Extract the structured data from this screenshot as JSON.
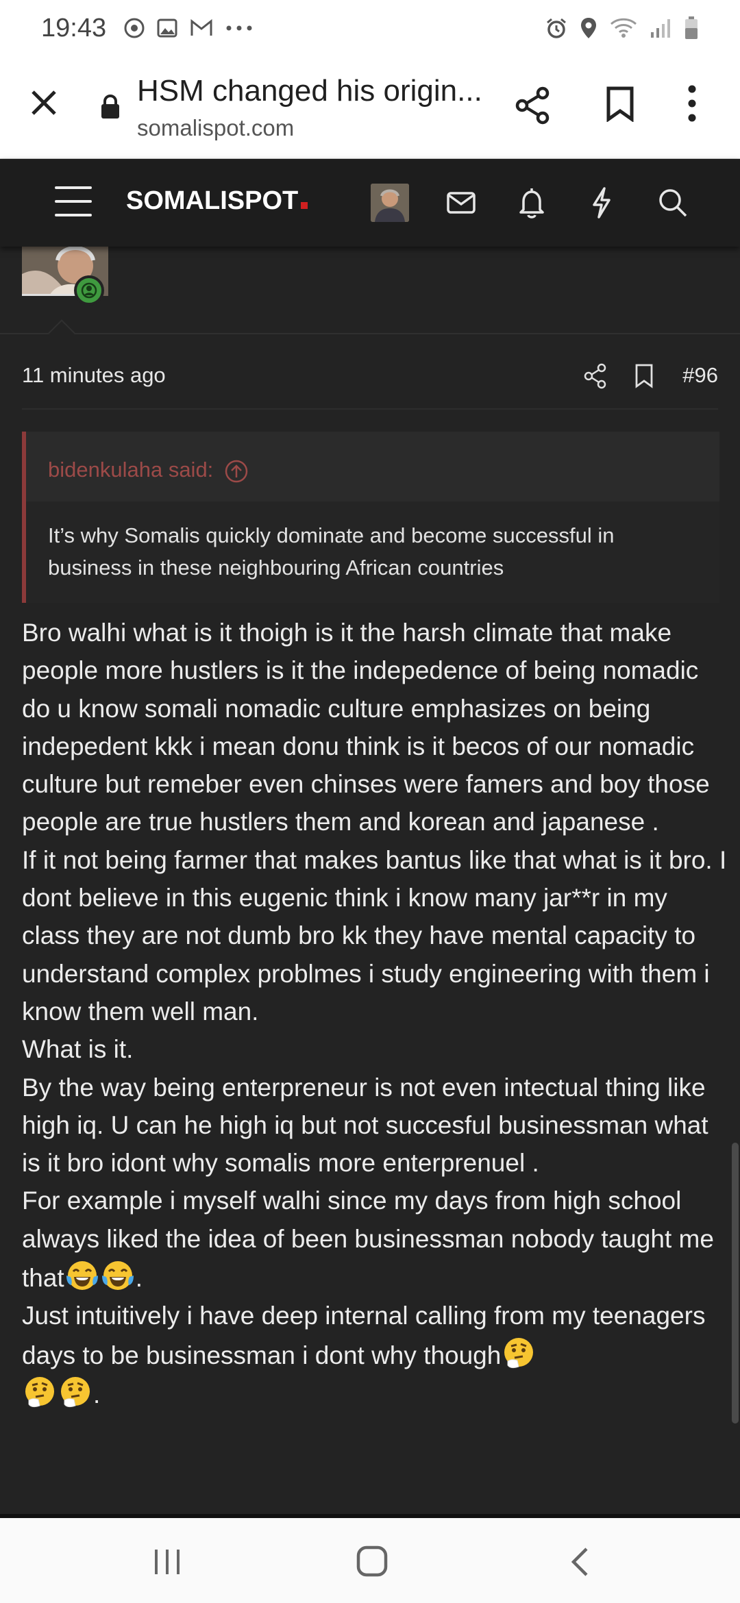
{
  "status_bar": {
    "time": "19:43",
    "left_icons": [
      "chrome-icon",
      "gallery-icon",
      "gmail-icon",
      "more-dots-icon"
    ],
    "right_icons": [
      "alarm-icon",
      "location-icon",
      "wifi-icon",
      "signal-icon",
      "battery-icon"
    ]
  },
  "browser": {
    "page_title": "HSM changed his origin...",
    "url": "somalispot.com"
  },
  "site": {
    "logo": "SOMALISPOT",
    "logo_accent": "#d02020"
  },
  "post": {
    "time_ago": "11 minutes ago",
    "number": "#96",
    "quote": {
      "author_line": "bidenkulaha said:",
      "text": "It’s why Somalis quickly dominate and become successful in business in these neighbouring African countries"
    },
    "paragraphs": {
      "p1": "Bro walhi what is it thoigh is it the harsh climate that make people more hustlers is it the indepedence of being nomadic do u know somali nomadic culture emphasizes on being indepedent kkk i mean donu think is it becos of our nomadic culture but remeber even chinses were famers and boy those people are true hustlers them and korean and japanese .",
      "p2": "If it not being farmer that makes bantus like that what is it bro. I dont believe in this eugenic think i know many jar**r in my class they are not dumb bro kk they have mental capacity to understand complex problmes i study engineering with them i know them well man.",
      "p3": "What is it.",
      "p4": "By the way being enterpreneur is not even intectual thing like high iq. U can he high iq but not succesful businessman what is it bro idont why somalis more enterprenuel .",
      "p5": "For example i myself walhi since my days from high school always liked the idea of been businessman nobody taught me that",
      "p5_end": ".",
      "p6": "Just intuitively i have deep internal calling from my teenagers days to be businessman i dont why though",
      "p6_end": "."
    }
  },
  "colors": {
    "page_bg": "#232323",
    "header_bg": "#1d1d1d",
    "quote_accent": "#8c3a3a",
    "quote_author": "#9c4a48",
    "online_badge": "#3f9a3f"
  }
}
